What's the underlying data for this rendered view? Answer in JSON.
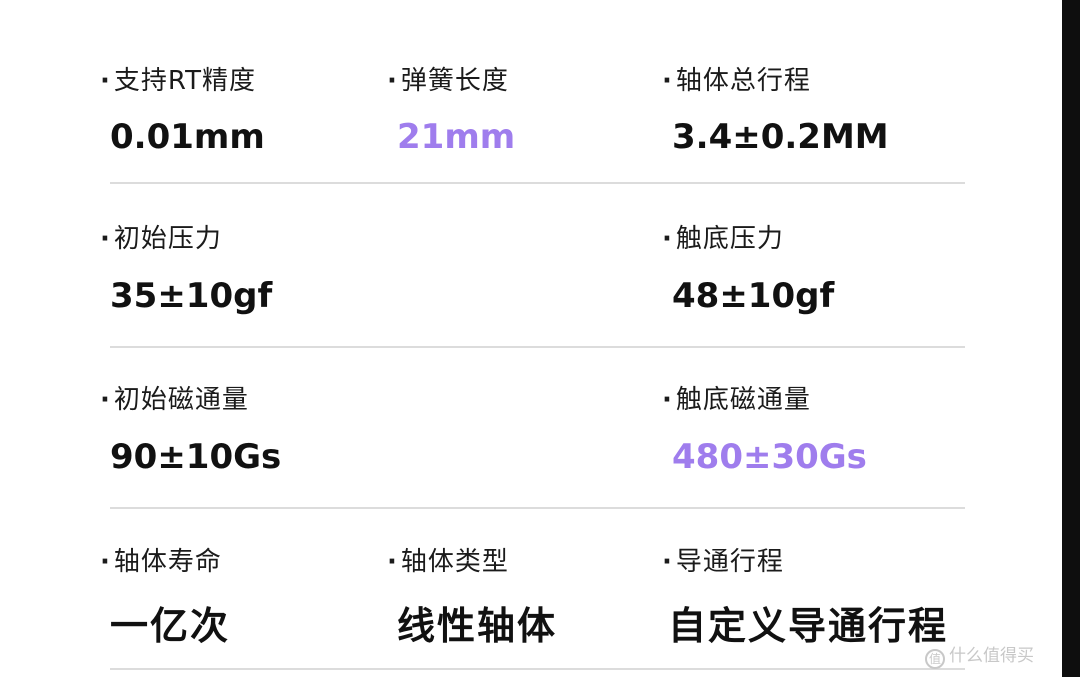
{
  "specs": {
    "row1": {
      "c1": {
        "label": "支持RT精度",
        "value": "0.01mm"
      },
      "c2": {
        "label": "弹簧长度",
        "value": "21mm"
      },
      "c3": {
        "label": "轴体总行程",
        "value": "3.4±0.2MM"
      }
    },
    "row2": {
      "c1": {
        "label": "初始压力",
        "value": "35±10gf"
      },
      "c3": {
        "label": "触底压力",
        "value": "48±10gf"
      }
    },
    "row3": {
      "c1": {
        "label": "初始磁通量",
        "value": "90±10Gs"
      },
      "c3": {
        "label": "触底磁通量",
        "value": "480±30Gs"
      }
    },
    "row4": {
      "c1": {
        "label": "轴体寿命",
        "value": "一亿次"
      },
      "c2": {
        "label": "轴体类型",
        "value": "线性轴体"
      },
      "c3": {
        "label": "导通行程",
        "value": "自定义导通行程"
      }
    }
  },
  "bullet": "·",
  "watermark": {
    "icon": "值",
    "text": "什么值得买"
  },
  "colors": {
    "accent": "#9f7ded",
    "text": "#111111",
    "divider": "#dcdcdc"
  }
}
